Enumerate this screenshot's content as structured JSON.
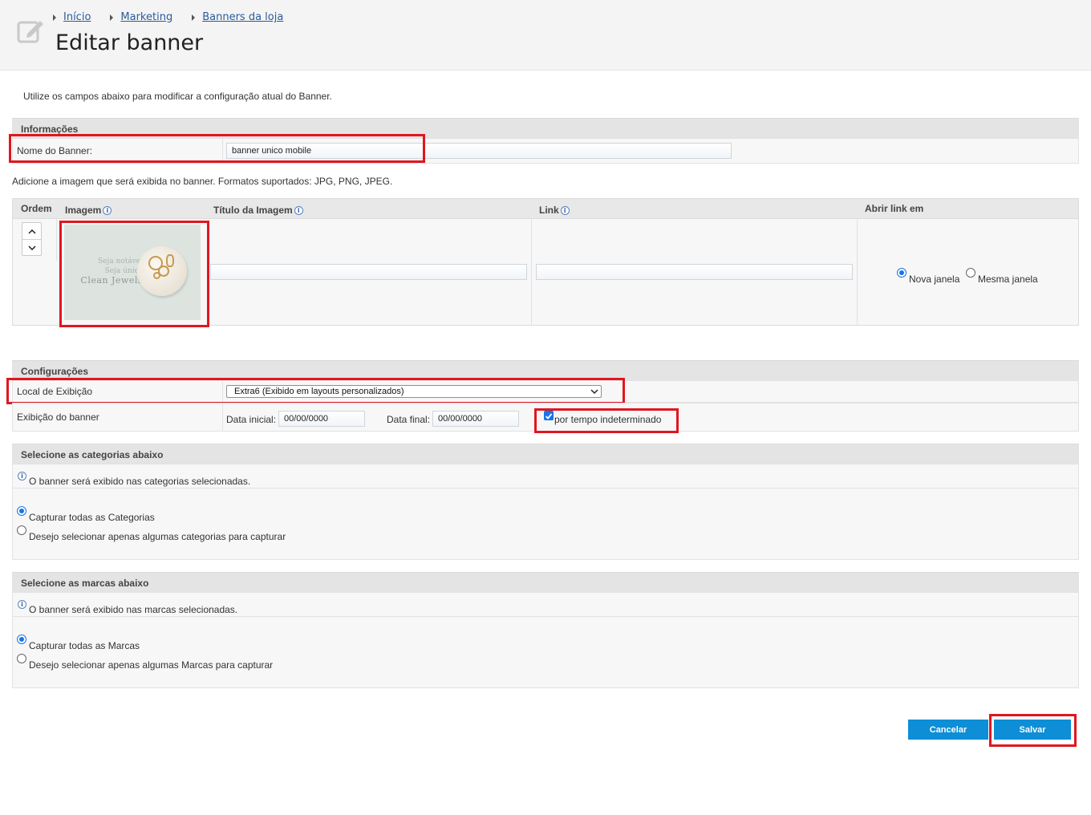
{
  "breadcrumb": [
    "Início",
    "Marketing",
    "Banners da loja"
  ],
  "page_title": "Editar banner",
  "intro": "Utilize os campos abaixo para modificar a configuração atual do Banner.",
  "informacoes": {
    "section_title": "Informações",
    "name_label": "Nome do Banner:",
    "name_value": "banner unico mobile"
  },
  "image_hint": "Adicione a imagem que será exibida no banner. Formatos suportados: JPG, PNG, JPEG.",
  "image_table": {
    "col_order": "Ordem",
    "col_image": "Imagem",
    "col_title": "Título da Imagem",
    "col_link": "Link",
    "col_open": "Abrir link em",
    "title_value": "",
    "link_value": "",
    "open_options": [
      "Nova janela",
      "Mesma janela"
    ],
    "open_selected": "Nova janela",
    "thumb_lines": [
      "Seja notável",
      "Seja única",
      "Clean Jewels"
    ]
  },
  "configuracoes": {
    "section_title": "Configurações",
    "local_label": "Local de Exibição",
    "local_value": "Extra6 (Exibido em layouts personalizados)",
    "exibicao_label": "Exibição do banner",
    "data_inicial_label": "Data inicial:",
    "data_inicial_value": "00/00/0000",
    "data_final_label": "Data final:",
    "data_final_value": "00/00/0000",
    "indeterminado_label": "por tempo indeterminado",
    "indeterminado_checked": true
  },
  "categorias": {
    "section_title": "Selecione as categorias abaixo",
    "info": "O banner será exibido nas categorias selecionadas.",
    "options": [
      "Capturar todas as Categorias",
      "Desejo selecionar apenas algumas categorias para capturar"
    ],
    "selected": "Capturar todas as Categorias"
  },
  "marcas": {
    "section_title": "Selecione as marcas abaixo",
    "info": "O banner será exibido nas marcas selecionadas.",
    "options": [
      "Capturar todas as Marcas",
      "Desejo selecionar apenas algumas Marcas para capturar"
    ],
    "selected": "Capturar todas as Marcas"
  },
  "actions": {
    "cancel": "Cancelar",
    "save": "Salvar"
  },
  "colors": {
    "highlight": "#e0161f",
    "button": "#0d8ed6",
    "section_bar": "#e4e4e4"
  }
}
